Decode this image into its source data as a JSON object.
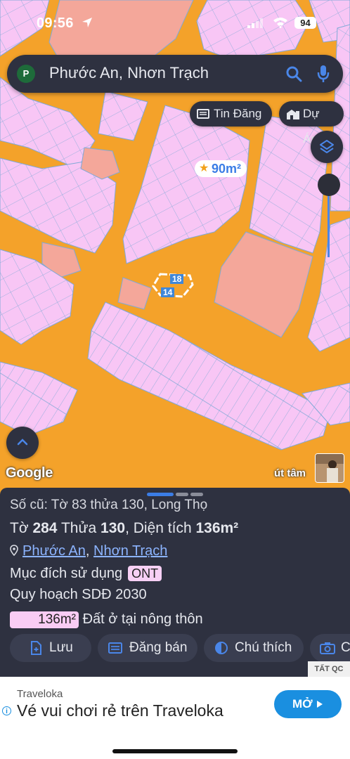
{
  "status": {
    "time": "09:56",
    "battery": "94"
  },
  "search": {
    "avatar": "P",
    "query": "Phước An, Nhơn Trạch"
  },
  "map_buttons": {
    "news": "Tin Đăng",
    "projects": "Dự Án"
  },
  "map": {
    "price_tag": "90m²",
    "parcel_labels": [
      "18",
      "14"
    ],
    "google": "Google",
    "user_label": "út tâm"
  },
  "sheet": {
    "old_id": "Số cũ: Tờ 83 thửa 130, Long Thọ",
    "parcel_prefix": "Tờ ",
    "sheet_no": "284",
    "plot_label": " Thửa ",
    "plot_no": "130",
    "area_label": ", Diện tích ",
    "area_value": "136m²",
    "location_ward": "Phước An",
    "location_sep": ", ",
    "location_district": "Nhơn Trạch",
    "purpose_label": "Mục đích sử dụng",
    "purpose_code": "ONT",
    "plan_label": "Quy hoạch SDĐ 2030",
    "plan_area": "136m²",
    "plan_desc": "Đất ở tại nông thôn"
  },
  "actions": {
    "save": "Lưu",
    "sell": "Đăng bán",
    "legend": "Chú thích",
    "camera": "C"
  },
  "ad": {
    "tag": "TẤT QC",
    "brand": "Traveloka",
    "title": "Vé vui chơi rẻ trên Traveloka",
    "button": "MỞ"
  },
  "colors": {
    "land": "#f8c6f5",
    "road": "#f4a22a",
    "plan_salmon": "#f4a79a",
    "panel": "#2e3140",
    "accent": "#3b7de6"
  }
}
